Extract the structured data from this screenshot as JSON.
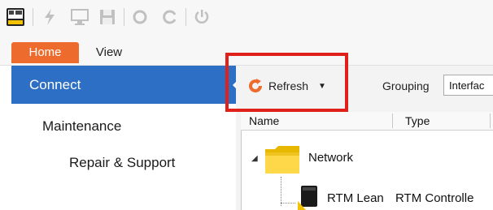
{
  "toolbar_icons": [
    "app-logo-icon",
    "flash-icon",
    "monitor-icon",
    "save-icon",
    "undo-icon",
    "redo-icon",
    "power-icon"
  ],
  "tabs": [
    {
      "label": "Home",
      "active": true
    },
    {
      "label": "View",
      "active": false
    }
  ],
  "nav": {
    "items": [
      {
        "label": "Connect",
        "selected": true
      },
      {
        "label": "Maintenance",
        "selected": false
      },
      {
        "label": "Repair & Support",
        "selected": false
      }
    ]
  },
  "actions": {
    "refresh_label": "Refresh",
    "grouping_label": "Grouping",
    "grouping_value": "Interfac"
  },
  "columns": [
    "Name",
    "Type"
  ],
  "tree": {
    "group": "Network",
    "device_name": "RTM Lean",
    "device_type": "RTM Controlle"
  },
  "colors": {
    "accent_orange": "#ec6b2d",
    "nav_selected": "#2d6fc4",
    "highlight_red": "#e0201b"
  }
}
